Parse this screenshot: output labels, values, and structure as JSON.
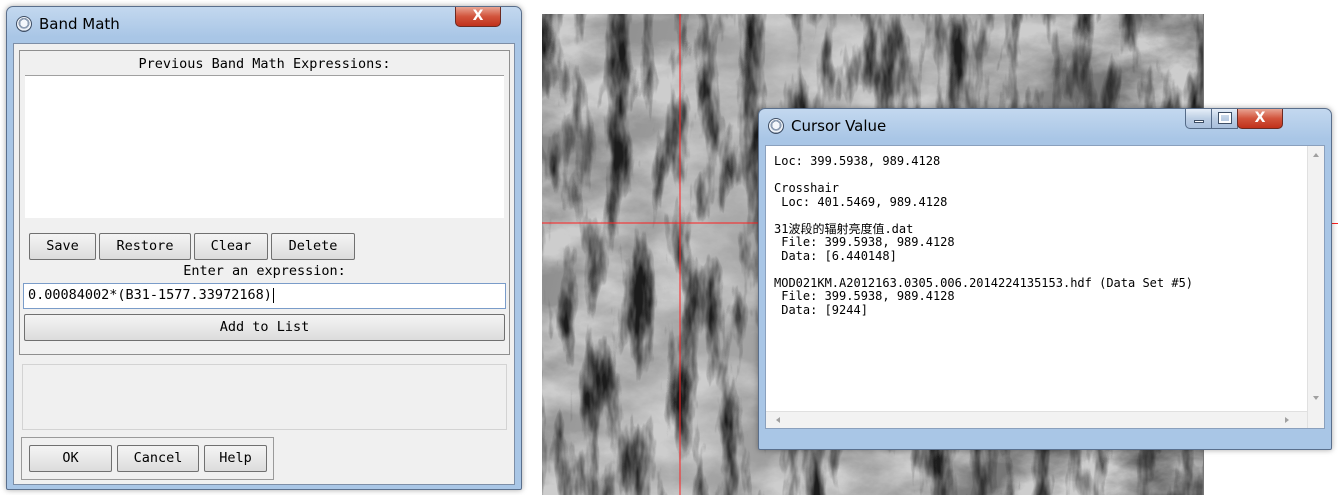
{
  "band_math": {
    "title": "Band Math",
    "close_glyph": "X",
    "previous_label": "Previous Band Math Expressions:",
    "buttons": {
      "save": "Save",
      "restore": "Restore",
      "clear": "Clear",
      "delete": "Delete"
    },
    "expression_label": "Enter an expression:",
    "expression_value": "0.00084002*(B31-1577.33972168)",
    "add_to_list": "Add to List",
    "ok": "OK",
    "cancel": "Cancel",
    "help": "Help"
  },
  "cursor_value": {
    "title": "Cursor Value",
    "close_glyph": "X",
    "lines": [
      "Loc: 399.5938, 989.4128",
      "",
      "Crosshair",
      " Loc: 401.5469, 989.4128",
      "",
      "31波段的辐射亮度值.dat",
      " File: 399.5938, 989.4128",
      " Data: [6.440148]",
      "",
      "MOD021KM.A2012163.0305.006.2014224135153.hdf (Data Set #5)",
      " File: 399.5938, 989.4128",
      " Data: [9244]"
    ]
  },
  "colors": {
    "crosshair": "#ff2020",
    "window_frame": "#a9c6e6",
    "close_button": "#c9402a"
  }
}
